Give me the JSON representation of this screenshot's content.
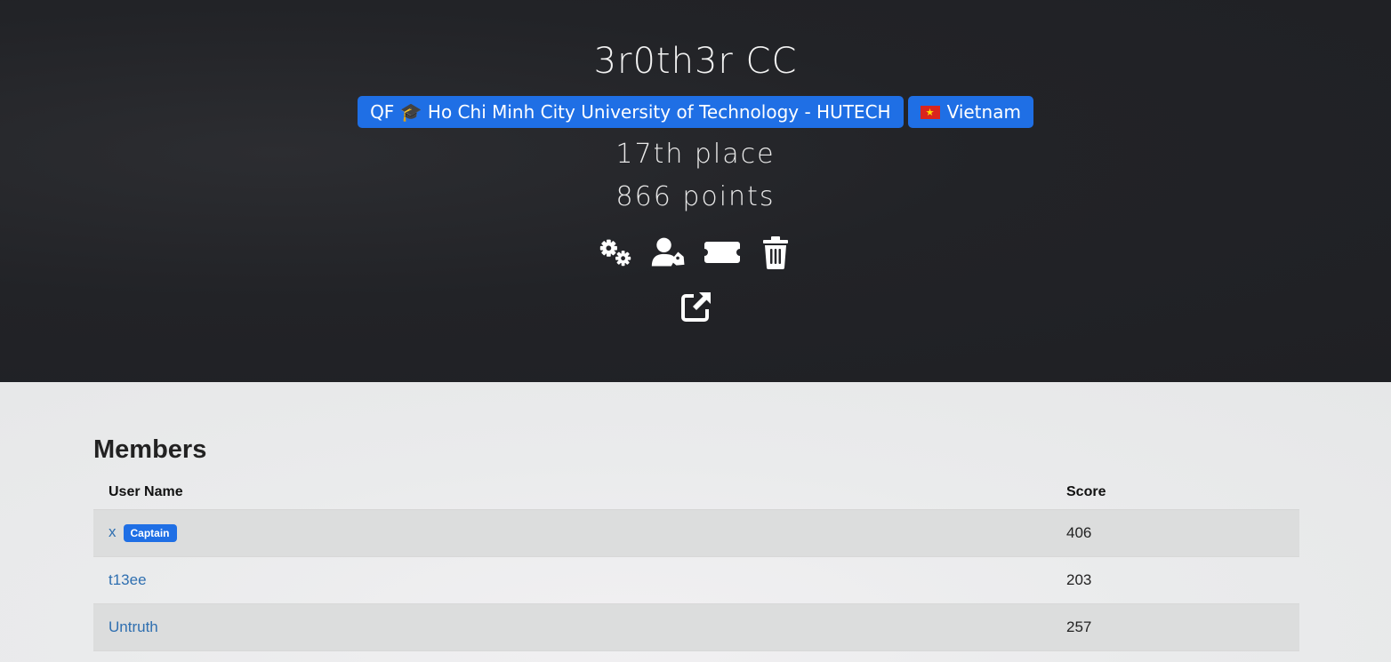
{
  "team": {
    "name": "3r0th3r CC",
    "affiliation": "QF 🎓 Ho Chi Minh City University of Technology - HUTECH",
    "country": "Vietnam",
    "place": "17th place",
    "points": "866 points"
  },
  "actions": {
    "icons": [
      "settings-icon",
      "user-tag-icon",
      "ticket-icon",
      "trash-icon",
      "external-link-icon"
    ]
  },
  "members": {
    "title": "Members",
    "columns": [
      "User Name",
      "Score"
    ],
    "rows": [
      {
        "name": "x",
        "badge": "Captain",
        "score": "406"
      },
      {
        "name": "t13ee",
        "badge": "",
        "score": "203"
      },
      {
        "name": "Untruth",
        "badge": "",
        "score": "257"
      }
    ]
  },
  "colors": {
    "accent": "#1f6fe5",
    "link": "#2f6fb0",
    "header_bg": "#222327"
  }
}
